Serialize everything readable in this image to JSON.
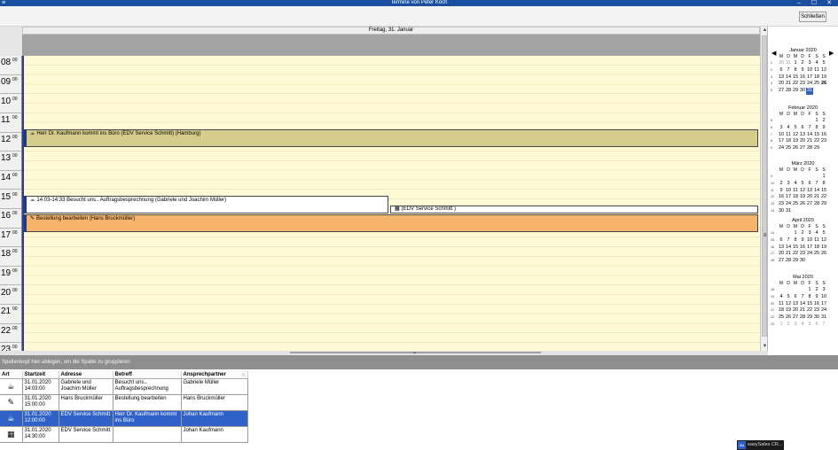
{
  "window": {
    "title": "Termine von Peter Koch",
    "menu_glyph": "≡",
    "minimize": "–",
    "maximize": "☐",
    "close": "✕"
  },
  "toolbar": {
    "close_label": "Schließen"
  },
  "calendar": {
    "day_label": "Freitag, 31. Januar",
    "hours": [
      {
        "h": "08",
        "m": "00"
      },
      {
        "h": "09",
        "m": "00"
      },
      {
        "h": "10",
        "m": "00"
      },
      {
        "h": "11",
        "m": "00"
      },
      {
        "h": "12",
        "m": "00"
      },
      {
        "h": "13",
        "m": "00"
      },
      {
        "h": "14",
        "m": "00"
      },
      {
        "h": "15",
        "m": "00"
      },
      {
        "h": "16",
        "m": "00"
      },
      {
        "h": "17",
        "m": "00"
      },
      {
        "h": "18",
        "m": "00"
      },
      {
        "h": "19",
        "m": "00"
      },
      {
        "h": "20",
        "m": "00"
      },
      {
        "h": "21",
        "m": "00"
      },
      {
        "h": "22",
        "m": "00"
      },
      {
        "h": "23",
        "m": "00"
      }
    ],
    "appointments": [
      {
        "text": "Herr Dr. Kaufmann kommt ins Büro (EDV Service Schmitt) (Hamburg)",
        "icon": "coffee-cup-icon"
      },
      {
        "text": "14:03-14:33 Besucht uns.. Auftragsbesprechnung (Gabriele und Joachim Müller)",
        "icon": "coffee-cup-icon"
      },
      {
        "text": "(EDV Service Schmitt )",
        "icon": "calculator-icon"
      },
      {
        "text": "Bestellung bearbeiten (Hans Bruckmüller)",
        "icon": "task-icon"
      }
    ]
  },
  "scroll": {
    "up": "▲",
    "down": "▼",
    "grip": "≡",
    "collapse": "⌄"
  },
  "minicalendar": {
    "prev": "◀",
    "next": "▶",
    "weekday_headers": [
      "M",
      "D",
      "M",
      "D",
      "F",
      "S",
      "S"
    ],
    "months": [
      {
        "name": "Januar 2020",
        "weeks": [
          {
            "wn": "1",
            "days": [
              "30",
              "31",
              "1",
              "2",
              "3",
              "4",
              "5"
            ]
          },
          {
            "wn": "2",
            "days": [
              "6",
              "7",
              "8",
              "9",
              "10",
              "11",
              "12"
            ]
          },
          {
            "wn": "3",
            "days": [
              "13",
              "14",
              "15",
              "16",
              "17",
              "18",
              "19"
            ]
          },
          {
            "wn": "4",
            "days": [
              "20",
              "21",
              "22",
              "23",
              "24",
              "25",
              "26"
            ]
          },
          {
            "wn": "5",
            "days": [
              "27",
              "28",
              "29",
              "30",
              "31",
              "",
              ""
            ]
          }
        ]
      },
      {
        "name": "Februar 2020",
        "weeks": [
          {
            "wn": "5",
            "days": [
              "",
              "",
              "",
              "",
              "",
              "1",
              "2"
            ]
          },
          {
            "wn": "6",
            "days": [
              "3",
              "4",
              "5",
              "6",
              "7",
              "8",
              "9"
            ]
          },
          {
            "wn": "7",
            "days": [
              "10",
              "11",
              "12",
              "13",
              "14",
              "15",
              "16"
            ]
          },
          {
            "wn": "8",
            "days": [
              "17",
              "18",
              "19",
              "20",
              "21",
              "22",
              "23"
            ]
          },
          {
            "wn": "9",
            "days": [
              "24",
              "25",
              "26",
              "27",
              "28",
              "29",
              ""
            ]
          }
        ]
      },
      {
        "name": "März 2020",
        "weeks": [
          {
            "wn": "9",
            "days": [
              "",
              "",
              "",
              "",
              "",
              "",
              "1"
            ]
          },
          {
            "wn": "10",
            "days": [
              "2",
              "3",
              "4",
              "5",
              "6",
              "7",
              "8"
            ]
          },
          {
            "wn": "11",
            "days": [
              "9",
              "10",
              "11",
              "12",
              "13",
              "14",
              "15"
            ]
          },
          {
            "wn": "12",
            "days": [
              "16",
              "17",
              "18",
              "19",
              "20",
              "21",
              "22"
            ]
          },
          {
            "wn": "13",
            "days": [
              "23",
              "24",
              "25",
              "26",
              "27",
              "28",
              "29"
            ]
          },
          {
            "wn": "14",
            "days": [
              "30",
              "31",
              "",
              "",
              "",
              "",
              ""
            ]
          }
        ]
      },
      {
        "name": "April 2020",
        "weeks": [
          {
            "wn": "14",
            "days": [
              "",
              "",
              "1",
              "2",
              "3",
              "4",
              "5"
            ]
          },
          {
            "wn": "15",
            "days": [
              "6",
              "7",
              "8",
              "9",
              "10",
              "11",
              "12"
            ]
          },
          {
            "wn": "16",
            "days": [
              "13",
              "14",
              "15",
              "16",
              "17",
              "18",
              "19"
            ]
          },
          {
            "wn": "17",
            "days": [
              "20",
              "21",
              "22",
              "23",
              "24",
              "25",
              "26"
            ]
          },
          {
            "wn": "18",
            "days": [
              "27",
              "28",
              "29",
              "30",
              "",
              "",
              ""
            ]
          }
        ]
      },
      {
        "name": "Mai 2020",
        "weeks": [
          {
            "wn": "18",
            "days": [
              "",
              "",
              "",
              "",
              "1",
              "2",
              "3"
            ]
          },
          {
            "wn": "19",
            "days": [
              "4",
              "5",
              "6",
              "7",
              "8",
              "9",
              "10"
            ]
          },
          {
            "wn": "20",
            "days": [
              "11",
              "12",
              "13",
              "14",
              "15",
              "16",
              "17"
            ]
          },
          {
            "wn": "21",
            "days": [
              "18",
              "19",
              "20",
              "21",
              "22",
              "23",
              "24"
            ]
          },
          {
            "wn": "22",
            "days": [
              "25",
              "26",
              "27",
              "28",
              "29",
              "30",
              "31"
            ]
          },
          {
            "wn": "23",
            "days": [
              "1",
              "2",
              "3",
              "4",
              "5",
              "6",
              "7"
            ]
          }
        ]
      }
    ]
  },
  "grouping": {
    "hint": "Spaltenkopf hier ablegen, um die Spalte zu gruppieren"
  },
  "list": {
    "columns": [
      "Art",
      "Startzeit",
      "Adresse",
      "Betreff",
      "Ansprechpartner"
    ],
    "sort_glyph": "△",
    "rows": [
      {
        "art_icon": "coffee-cup-icon",
        "art_glyph": "☕",
        "start_date": "31.01.2020",
        "start_time": "14:03:00",
        "adresse": "Gabriele und Joachim Müller",
        "betreff": "Besucht uns.. Auftragsbesprechnung",
        "ansprechpartner": "Gabriele Müller"
      },
      {
        "art_icon": "task-icon",
        "art_glyph": "✎",
        "start_date": "31.01.2020",
        "start_time": "15:00:00",
        "adresse": "Hans Bruckmüller",
        "betreff": "Bestellung bearbeiten",
        "ansprechpartner": "Hans Bruckmüller"
      },
      {
        "art_icon": "coffee-cup-icon",
        "art_glyph": "☕",
        "start_date": "31.01.2020",
        "start_time": "12:00:00",
        "adresse": "EDV Service Schmitt",
        "betreff": "Herr Dr. Kaufmann kommt ins Büro",
        "ansprechpartner": "Johan Kaufmann"
      },
      {
        "art_icon": "calculator-icon",
        "art_glyph": "▦",
        "start_date": "31.01.2020",
        "start_time": "14:30:00",
        "adresse": "EDV Service Schmitt",
        "betreff": "",
        "ansprechpartner": "Johan Kaufmann"
      }
    ]
  },
  "taskbar": {
    "icon_text": "Ms",
    "label": "easySales CR..."
  }
}
